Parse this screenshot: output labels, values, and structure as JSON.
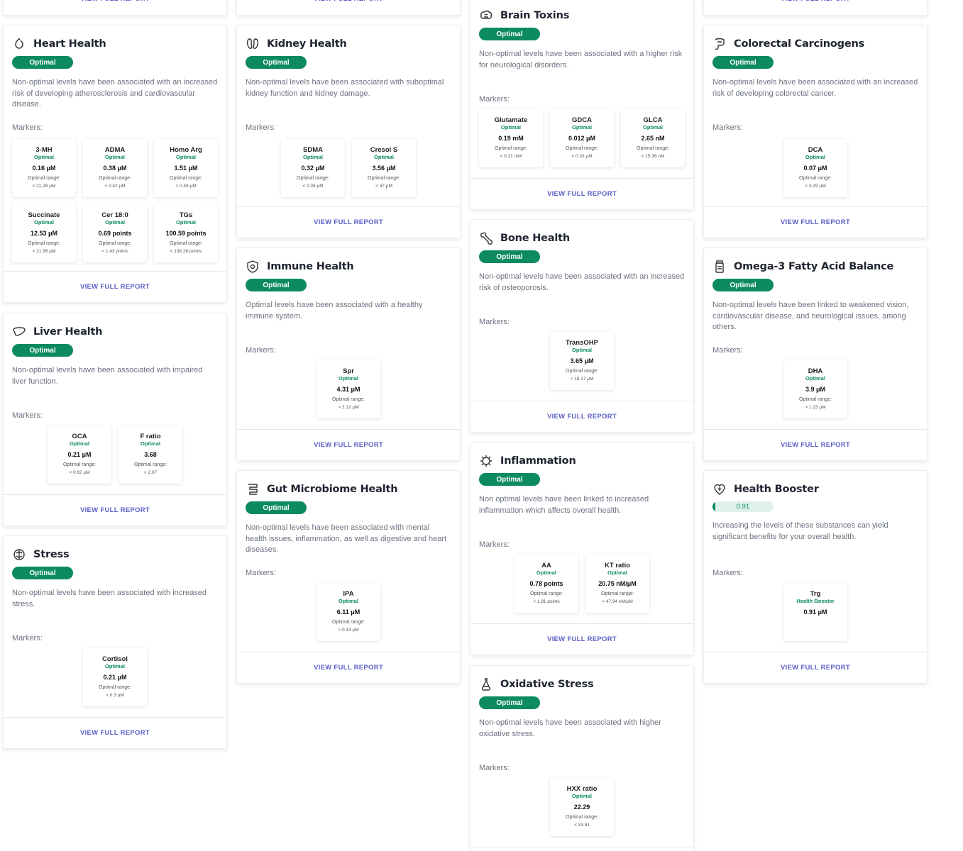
{
  "footer_label": "VIEW FULL REPORT",
  "accent_color": "#0c8a62",
  "link_color": "#5b5fc7",
  "cards": {
    "heart": {
      "title": "Heart Health",
      "icon": "heart-icon",
      "status": "Optimal",
      "desc": "Non-optimal levels have been associated with an increased risk of developing atherosclerosis and cardiovascular disease.",
      "markers_label": "Markers:",
      "markers": [
        {
          "name": "3-MH",
          "status": "Optimal",
          "value": "0.16 μM",
          "range_label": "Optimal range:",
          "range": "< 21.28 μM"
        },
        {
          "name": "ADMA",
          "status": "Optimal",
          "value": "0.38 μM",
          "range_label": "Optimal range:",
          "range": "< 0.42 μM"
        },
        {
          "name": "Homo Arg",
          "status": "Optimal",
          "value": "1.51 μM",
          "range_label": "Optimal range:",
          "range": "> 0.49 μM"
        },
        {
          "name": "Succinate",
          "status": "Optimal",
          "value": "12.53 μM",
          "range_label": "Optimal range:",
          "range": "< 21.96 μM"
        },
        {
          "name": "Cer 18:0",
          "status": "Optimal",
          "value": "0.69 points",
          "range_label": "Optimal range:",
          "range": "< 1.43 points"
        },
        {
          "name": "TGs",
          "status": "Optimal",
          "value": "100.59 points",
          "range_label": "Optimal range:",
          "range": "< 138.26 points"
        }
      ]
    },
    "liver": {
      "title": "Liver Health",
      "icon": "liver-icon",
      "status": "Optimal",
      "desc": "Non-optimal levels have been associated with impaired liver function.",
      "markers_label": "Markers:",
      "markers": [
        {
          "name": "GCA",
          "status": "Optimal",
          "value": "0.21 μM",
          "range_label": "Optimal range:",
          "range": "< 0.62 μM"
        },
        {
          "name": "F ratio",
          "status": "Optimal",
          "value": "3.68",
          "range_label": "Optimal range:",
          "range": "> 2.07"
        }
      ]
    },
    "stress": {
      "title": "Stress",
      "icon": "brain-stress-icon",
      "status": "Optimal",
      "desc": "Non-optimal levels have been associated with increased stress.",
      "markers_label": "Markers:",
      "markers": [
        {
          "name": "Cortisol",
          "status": "Optimal",
          "value": "0.21 μM",
          "range_label": "Optimal range:",
          "range": "< 0.3 μM"
        }
      ]
    },
    "kidney": {
      "title": "Kidney Health",
      "icon": "kidney-icon",
      "status": "Optimal",
      "desc": "Non-optimal levels have been associated with suboptimal kidney function and kidney damage.",
      "markers_label": "Markers:",
      "markers": [
        {
          "name": "SDMA",
          "status": "Optimal",
          "value": "0.32 μM",
          "range_label": "Optimal range:",
          "range": "< 0.36 μM"
        },
        {
          "name": "Cresol S",
          "status": "Optimal",
          "value": "3.56 μM",
          "range_label": "Optimal range:",
          "range": "< 47 μM"
        }
      ]
    },
    "immune": {
      "title": "Immune Health",
      "icon": "shield-icon",
      "status": "Optimal",
      "desc": "Optimal levels have been associated with a healthy immune system.",
      "markers_label": "Markers:",
      "markers": [
        {
          "name": "Spr",
          "status": "Optimal",
          "value": "4.31 μM",
          "range_label": "Optimal range:",
          "range": "> 2.12 μM"
        }
      ]
    },
    "gut": {
      "title": "Gut Microbiome Health",
      "icon": "gut-icon",
      "status": "Optimal",
      "desc": "Non-optimal levels have been associated with mental health issues, inflammation, as well as digestive and heart diseases.",
      "markers_label": "Markers:",
      "markers": [
        {
          "name": "IPA",
          "status": "Optimal",
          "value": "6.11 μM",
          "range_label": "Optimal range:",
          "range": "> 0.14 μM"
        }
      ]
    },
    "brain": {
      "title": "Brain Toxins",
      "icon": "brain-icon",
      "status": "Optimal",
      "desc": "Non-optimal levels have been associated with a higher risk for neurological disorders.",
      "markers_label": "Markers:",
      "markers": [
        {
          "name": "Glutamate",
          "status": "Optimal",
          "value": "0.19 mM",
          "range_label": "Optimal range:",
          "range": "< 0.21 mM"
        },
        {
          "name": "GDCA",
          "status": "Optimal",
          "value": "0.012 μM",
          "range_label": "Optimal range:",
          "range": "< 0.33 μM"
        },
        {
          "name": "GLCA",
          "status": "Optimal",
          "value": "2.65 nM",
          "range_label": "Optimal range:",
          "range": "< 15.36 nM"
        }
      ]
    },
    "bone": {
      "title": "Bone Health",
      "icon": "bone-icon",
      "status": "Optimal",
      "desc": "Non-optimal levels have been associated with an increased risk of osteoporosis.",
      "markers_label": "Markers:",
      "markers": [
        {
          "name": "TransOHP",
          "status": "Optimal",
          "value": "3.65 μM",
          "range_label": "Optimal range:",
          "range": "< 18.17 μM"
        }
      ]
    },
    "inflammation": {
      "title": "Inflammation",
      "icon": "virus-icon",
      "status": "Optimal",
      "desc": "Non optimal levels have been linked to increased inflammation which affects overall health.",
      "markers_label": "Markers:",
      "markers": [
        {
          "name": "AA",
          "status": "Optimal",
          "value": "0.78 points",
          "range_label": "Optimal range:",
          "range": "< 1.91 points"
        },
        {
          "name": "KT ratio",
          "status": "Optimal",
          "value": "20.75 nM/μM",
          "range_label": "Optimal range:",
          "range": "< 47.94 nM/μM"
        }
      ]
    },
    "oxidative": {
      "title": "Oxidative Stress",
      "icon": "flask-icon",
      "status": "Optimal",
      "desc": "Non-optimal levels have been associated with higher oxidative stress.",
      "markers_label": "Markers:",
      "markers": [
        {
          "name": "HXX ratio",
          "status": "Optimal",
          "value": "22.29",
          "range_label": "Optimal range:",
          "range": "< 33.81"
        }
      ]
    },
    "colorectal": {
      "title": "Colorectal Carcinogens",
      "icon": "intestine-icon",
      "status": "Optimal",
      "desc": "Non-optimal levels have been associated with an increased risk of developing colorectal cancer.",
      "markers_label": "Markers:",
      "markers": [
        {
          "name": "DCA",
          "status": "Optimal",
          "value": "0.07 μM",
          "range_label": "Optimal range:",
          "range": "< 0.29 μM"
        }
      ]
    },
    "omega": {
      "title": "Omega-3 Fatty Acid Balance",
      "icon": "supplement-bottle-icon",
      "status": "Optimal",
      "desc": "Non-optimal levels have been linked to weakened vision, cardiovascular disease, and neurological issues, among others.",
      "markers_label": "Markers:",
      "markers": [
        {
          "name": "DHA",
          "status": "Optimal",
          "value": "3.9 μM",
          "range_label": "Optimal range:",
          "range": "> 1.23 μM"
        }
      ]
    },
    "booster": {
      "title": "Health Booster",
      "icon": "heart-plus-icon",
      "score": "0.91",
      "score_fraction": 0.05,
      "desc": "Increasing the levels of these substances can yield significant benefits for your overall health.",
      "markers_label": "Markers:",
      "markers": [
        {
          "name": "Trg",
          "status": "Health Booster",
          "value": "0.91 μM"
        }
      ]
    }
  }
}
